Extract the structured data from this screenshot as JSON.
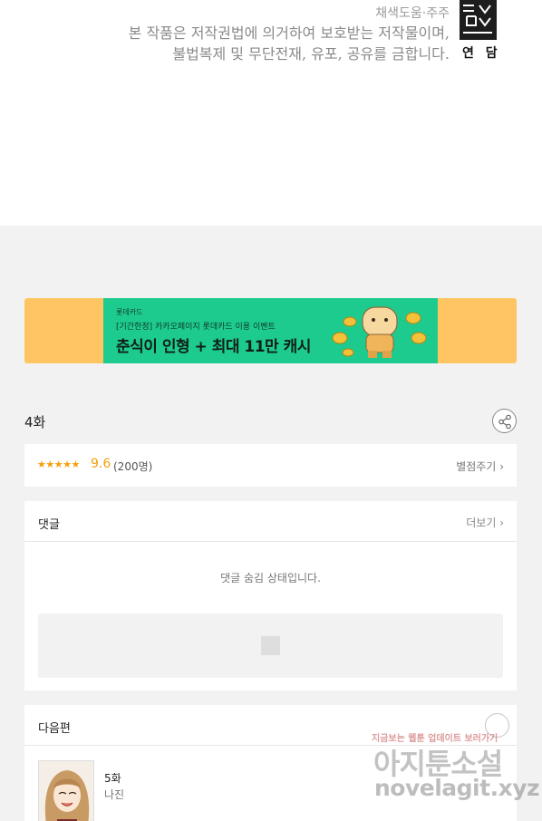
{
  "credits": {
    "line1": "채색도움·주주",
    "line2": "본 작품은 저작권법에 의거하여 보호받는 저작물이며,",
    "line3": "불법복제 및 무단전재, 유포, 공유를 금합니다."
  },
  "logo": {
    "label": "연 담"
  },
  "banner": {
    "brand": "롯데카드",
    "subtitle": "[기간한정] 카카오페이지 롯데카드 이용 이벤트",
    "headline": "춘식이 인형 + 최대 11만 캐시",
    "colors": {
      "outer": "#ffc562",
      "inner": "#1ecb8f"
    }
  },
  "episode": {
    "title": "4화"
  },
  "rating": {
    "stars": "★★★★★",
    "score": "9.6",
    "count": "(200명)",
    "rate_label": "별점주기"
  },
  "comments": {
    "title": "댓글",
    "more_label": "더보기",
    "hidden_message": "댓글 숨김 상태입니다."
  },
  "next_episode": {
    "section_title": "다음편",
    "episode": "5화",
    "author": "나진"
  },
  "watermark": {
    "line1": "지금보는 웹툰 업데이트 보러가기",
    "line2": "아지툰소설",
    "line3": "novelagit.xyz"
  }
}
